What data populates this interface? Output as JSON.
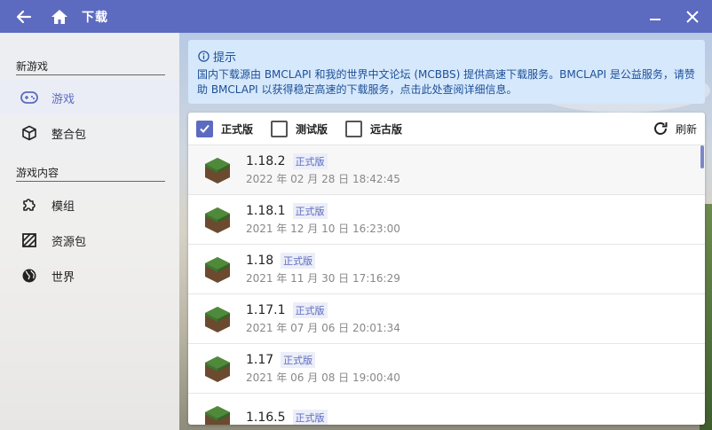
{
  "titlebar": {
    "title": "下载",
    "back_icon": "arrow-left-icon",
    "home_icon": "home-icon",
    "min_icon": "minimize-icon",
    "close_icon": "close-icon",
    "color": "#5c6bc0"
  },
  "sidebar": {
    "section1": "新游戏",
    "section2": "游戏内容",
    "items": [
      {
        "label": "游戏",
        "icon": "gamepad-icon",
        "active": true
      },
      {
        "label": "整合包",
        "icon": "cube-icon",
        "active": false
      },
      {
        "label": "模组",
        "icon": "puzzle-icon",
        "active": false
      },
      {
        "label": "资源包",
        "icon": "texture-icon",
        "active": false
      },
      {
        "label": "世界",
        "icon": "globe-icon",
        "active": false
      }
    ]
  },
  "hint": {
    "title": "提示",
    "body": "国内下载源由 BMCLAPI 和我的世界中文论坛 (MCBBS) 提供高速下载服务。BMCLAPI 是公益服务，请赞助 BMCLAPI 以获得稳定高速的下载服务，点击此处查阅详细信息。"
  },
  "filters": [
    {
      "label": "正式版",
      "checked": true
    },
    {
      "label": "测试版",
      "checked": false
    },
    {
      "label": "远古版",
      "checked": false
    }
  ],
  "refresh_label": "刷新",
  "versions": [
    {
      "version": "1.18.2",
      "tag": "正式版",
      "date": "2022 年 02 月 28 日 18:42:45"
    },
    {
      "version": "1.18.1",
      "tag": "正式版",
      "date": "2021 年 12 月 10 日 16:23:00"
    },
    {
      "version": "1.18",
      "tag": "正式版",
      "date": "2021 年 11 月 30 日 17:16:29"
    },
    {
      "version": "1.17.1",
      "tag": "正式版",
      "date": "2021 年 07 月 06 日 20:01:34"
    },
    {
      "version": "1.17",
      "tag": "正式版",
      "date": "2021 年 06 月 08 日 19:00:40"
    },
    {
      "version": "1.16.5",
      "tag": "正式版",
      "date": ""
    }
  ]
}
